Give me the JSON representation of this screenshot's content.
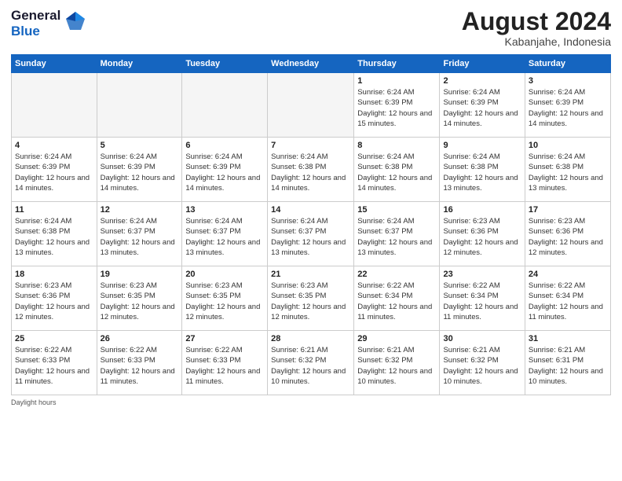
{
  "header": {
    "logo_general": "General",
    "logo_blue": "Blue",
    "month_year": "August 2024",
    "location": "Kabanjahe, Indonesia"
  },
  "days_of_week": [
    "Sunday",
    "Monday",
    "Tuesday",
    "Wednesday",
    "Thursday",
    "Friday",
    "Saturday"
  ],
  "weeks": [
    [
      {
        "day": "",
        "empty": true
      },
      {
        "day": "",
        "empty": true
      },
      {
        "day": "",
        "empty": true
      },
      {
        "day": "",
        "empty": true
      },
      {
        "day": "1",
        "sunrise": "6:24 AM",
        "sunset": "6:39 PM",
        "daylight": "12 hours and 15 minutes."
      },
      {
        "day": "2",
        "sunrise": "6:24 AM",
        "sunset": "6:39 PM",
        "daylight": "12 hours and 14 minutes."
      },
      {
        "day": "3",
        "sunrise": "6:24 AM",
        "sunset": "6:39 PM",
        "daylight": "12 hours and 14 minutes."
      }
    ],
    [
      {
        "day": "4",
        "sunrise": "6:24 AM",
        "sunset": "6:39 PM",
        "daylight": "12 hours and 14 minutes."
      },
      {
        "day": "5",
        "sunrise": "6:24 AM",
        "sunset": "6:39 PM",
        "daylight": "12 hours and 14 minutes."
      },
      {
        "day": "6",
        "sunrise": "6:24 AM",
        "sunset": "6:39 PM",
        "daylight": "12 hours and 14 minutes."
      },
      {
        "day": "7",
        "sunrise": "6:24 AM",
        "sunset": "6:38 PM",
        "daylight": "12 hours and 14 minutes."
      },
      {
        "day": "8",
        "sunrise": "6:24 AM",
        "sunset": "6:38 PM",
        "daylight": "12 hours and 14 minutes."
      },
      {
        "day": "9",
        "sunrise": "6:24 AM",
        "sunset": "6:38 PM",
        "daylight": "12 hours and 13 minutes."
      },
      {
        "day": "10",
        "sunrise": "6:24 AM",
        "sunset": "6:38 PM",
        "daylight": "12 hours and 13 minutes."
      }
    ],
    [
      {
        "day": "11",
        "sunrise": "6:24 AM",
        "sunset": "6:38 PM",
        "daylight": "12 hours and 13 minutes."
      },
      {
        "day": "12",
        "sunrise": "6:24 AM",
        "sunset": "6:37 PM",
        "daylight": "12 hours and 13 minutes."
      },
      {
        "day": "13",
        "sunrise": "6:24 AM",
        "sunset": "6:37 PM",
        "daylight": "12 hours and 13 minutes."
      },
      {
        "day": "14",
        "sunrise": "6:24 AM",
        "sunset": "6:37 PM",
        "daylight": "12 hours and 13 minutes."
      },
      {
        "day": "15",
        "sunrise": "6:24 AM",
        "sunset": "6:37 PM",
        "daylight": "12 hours and 13 minutes."
      },
      {
        "day": "16",
        "sunrise": "6:23 AM",
        "sunset": "6:36 PM",
        "daylight": "12 hours and 12 minutes."
      },
      {
        "day": "17",
        "sunrise": "6:23 AM",
        "sunset": "6:36 PM",
        "daylight": "12 hours and 12 minutes."
      }
    ],
    [
      {
        "day": "18",
        "sunrise": "6:23 AM",
        "sunset": "6:36 PM",
        "daylight": "12 hours and 12 minutes."
      },
      {
        "day": "19",
        "sunrise": "6:23 AM",
        "sunset": "6:35 PM",
        "daylight": "12 hours and 12 minutes."
      },
      {
        "day": "20",
        "sunrise": "6:23 AM",
        "sunset": "6:35 PM",
        "daylight": "12 hours and 12 minutes."
      },
      {
        "day": "21",
        "sunrise": "6:23 AM",
        "sunset": "6:35 PM",
        "daylight": "12 hours and 12 minutes."
      },
      {
        "day": "22",
        "sunrise": "6:22 AM",
        "sunset": "6:34 PM",
        "daylight": "12 hours and 11 minutes."
      },
      {
        "day": "23",
        "sunrise": "6:22 AM",
        "sunset": "6:34 PM",
        "daylight": "12 hours and 11 minutes."
      },
      {
        "day": "24",
        "sunrise": "6:22 AM",
        "sunset": "6:34 PM",
        "daylight": "12 hours and 11 minutes."
      }
    ],
    [
      {
        "day": "25",
        "sunrise": "6:22 AM",
        "sunset": "6:33 PM",
        "daylight": "12 hours and 11 minutes."
      },
      {
        "day": "26",
        "sunrise": "6:22 AM",
        "sunset": "6:33 PM",
        "daylight": "12 hours and 11 minutes."
      },
      {
        "day": "27",
        "sunrise": "6:22 AM",
        "sunset": "6:33 PM",
        "daylight": "12 hours and 11 minutes."
      },
      {
        "day": "28",
        "sunrise": "6:21 AM",
        "sunset": "6:32 PM",
        "daylight": "12 hours and 10 minutes."
      },
      {
        "day": "29",
        "sunrise": "6:21 AM",
        "sunset": "6:32 PM",
        "daylight": "12 hours and 10 minutes."
      },
      {
        "day": "30",
        "sunrise": "6:21 AM",
        "sunset": "6:32 PM",
        "daylight": "12 hours and 10 minutes."
      },
      {
        "day": "31",
        "sunrise": "6:21 AM",
        "sunset": "6:31 PM",
        "daylight": "12 hours and 10 minutes."
      }
    ]
  ],
  "footer": {
    "note": "Daylight hours"
  }
}
